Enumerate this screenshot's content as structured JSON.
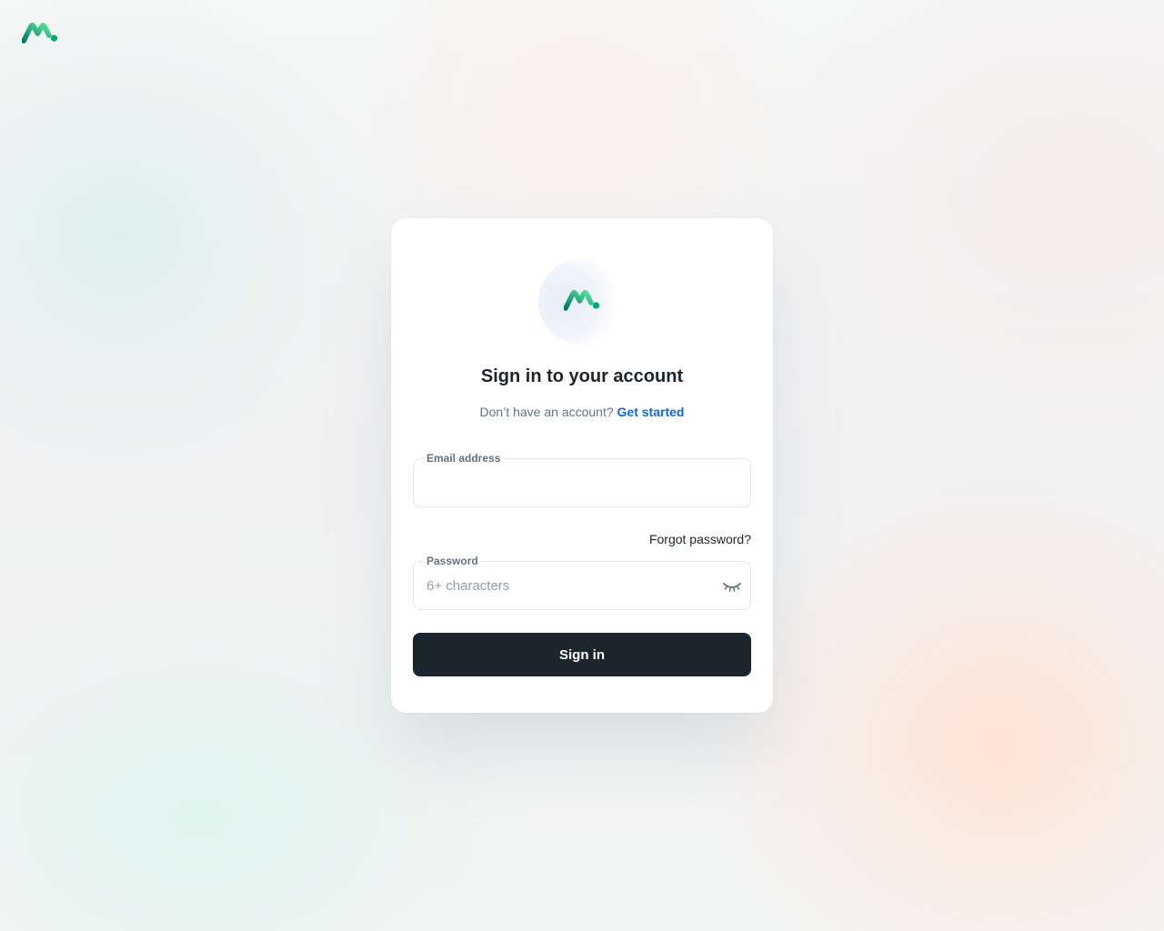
{
  "brand": {
    "logo_icon": "brand-logo-icon",
    "colors": {
      "primary": "#00a76f",
      "primary_dark": "#007867",
      "primary_light": "#5be49b"
    }
  },
  "card": {
    "title": "Sign in to your account",
    "no_account_text": "Don’t have an account?",
    "get_started_link": "Get started",
    "email": {
      "label": "Email address",
      "value": "",
      "placeholder": ""
    },
    "forgot_password": "Forgot password?",
    "password": {
      "label": "Password",
      "value": "",
      "placeholder": "6+ characters",
      "toggle_icon": "eye-closed-icon"
    },
    "submit_label": "Sign in"
  },
  "colors": {
    "button_bg": "#1c252e",
    "link": "#0c68e9",
    "text_primary": "#1c252e",
    "text_secondary": "#637381"
  }
}
